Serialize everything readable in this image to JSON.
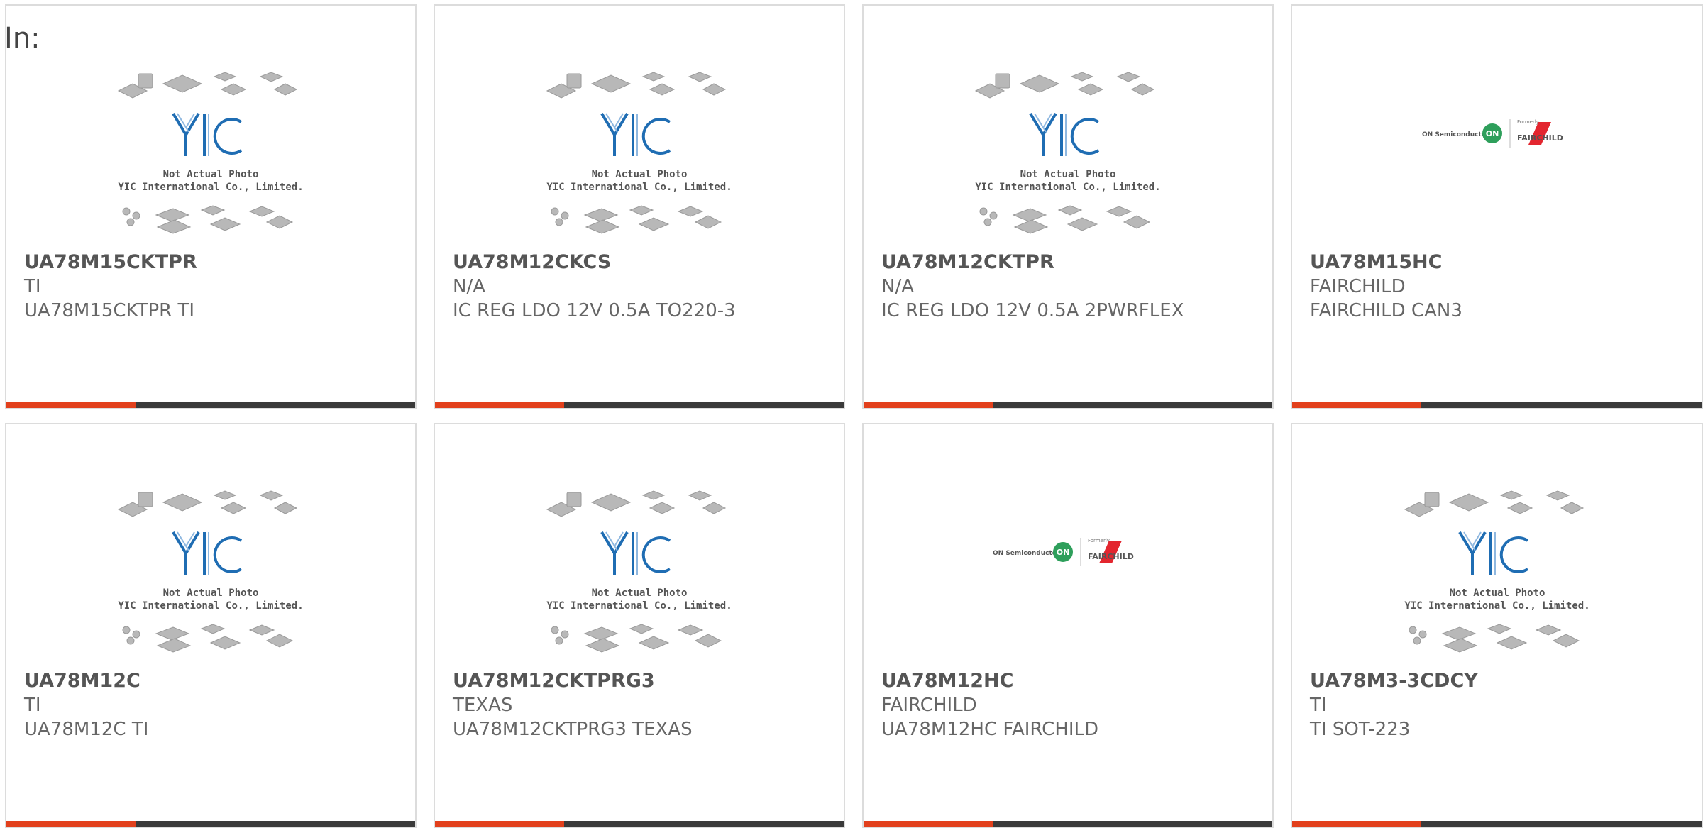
{
  "prefix": "In:",
  "colors": {
    "accent": "#e2401c",
    "bar": "#3a3a3a",
    "border": "#dcdcdc",
    "yic_blue": "#1f6db3"
  },
  "placeholder": {
    "line1": "Not Actual Photo",
    "line2": "YIC International Co., Limited.",
    "logo_text": "YIC"
  },
  "brand_logo": {
    "on_text": "ON Semiconductor",
    "on_badge": "ON",
    "formerly": "Formerly",
    "fairchild": "FAIRCHILD"
  },
  "products": [
    {
      "part": "UA78M15CKTPR",
      "mfr": "TI",
      "desc": "UA78M15CKTPR TI",
      "image": "yic-placeholder-icon"
    },
    {
      "part": "UA78M12CKCS",
      "mfr": "N/A",
      "desc": "IC REG LDO 12V 0.5A TO220-3",
      "image": "yic-placeholder-icon"
    },
    {
      "part": "UA78M12CKTPR",
      "mfr": "N/A",
      "desc": "IC REG LDO 12V 0.5A 2PWRFLEX",
      "image": "yic-placeholder-icon"
    },
    {
      "part": "UA78M15HC",
      "mfr": "FAIRCHILD",
      "desc": "FAIRCHILD CAN3",
      "image": "on-fairchild-logo-icon"
    },
    {
      "part": "UA78M12C",
      "mfr": "TI",
      "desc": "UA78M12C TI",
      "image": "yic-placeholder-icon"
    },
    {
      "part": "UA78M12CKTPRG3",
      "mfr": "TEXAS",
      "desc": "UA78M12CKTPRG3 TEXAS",
      "image": "yic-placeholder-icon"
    },
    {
      "part": "UA78M12HC",
      "mfr": "FAIRCHILD",
      "desc": "UA78M12HC FAIRCHILD",
      "image": "on-fairchild-logo-icon"
    },
    {
      "part": "UA78M3-3CDCY",
      "mfr": "TI",
      "desc": "TI SOT-223",
      "image": "yic-placeholder-icon"
    }
  ]
}
